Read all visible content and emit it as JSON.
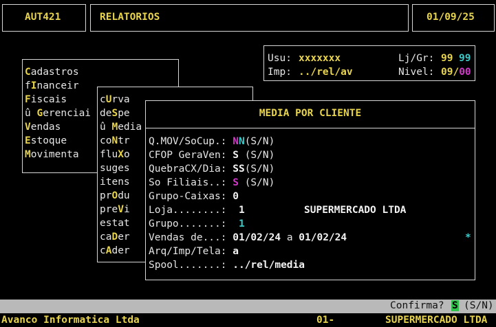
{
  "header": {
    "app_code": "AUT421",
    "section": "RELATORIOS",
    "date": "01/09/25"
  },
  "info_box": {
    "usu_label": "Usu:",
    "usu_value": "xxxxxxx",
    "lj_label": "Lj/Gr:",
    "lj_value": "99",
    "gr_value": "99",
    "imp_label": "Imp:",
    "imp_value": "../rel/av",
    "nivel_label": "Nivel:",
    "nivel_value": "09/",
    "nivel_value2": "00"
  },
  "main_menu": {
    "items": [
      {
        "pre": "",
        "hot": "C",
        "post": "adastros"
      },
      {
        "pre": "f",
        "hot": "I",
        "post": "nanceir"
      },
      {
        "pre": "",
        "hot": "F",
        "post": "iscais"
      },
      {
        "pre": "û ",
        "hot": "G",
        "post": "erenciai"
      },
      {
        "pre": "",
        "hot": "V",
        "post": "endas"
      },
      {
        "pre": "",
        "hot": "E",
        "post": "stoque"
      },
      {
        "pre": "",
        "hot": "M",
        "post": "ovimenta"
      }
    ]
  },
  "sub_menu": {
    "items": [
      {
        "pre": "c",
        "hot": "U",
        "post": "rva"
      },
      {
        "pre": "de",
        "hot": "S",
        "post": "pe"
      },
      {
        "pre": "û ",
        "hot": "M",
        "post": "edia"
      },
      {
        "pre": "co",
        "hot": "N",
        "post": "tr"
      },
      {
        "pre": "flu",
        "hot": "X",
        "post": "o"
      },
      {
        "pre": "suges",
        "hot": "",
        "post": ""
      },
      {
        "pre": "itens",
        "hot": "",
        "post": ""
      },
      {
        "pre": "pr",
        "hot": "O",
        "post": "du"
      },
      {
        "pre": "pre",
        "hot": "V",
        "post": "i"
      },
      {
        "pre": "estat",
        "hot": "",
        "post": ""
      },
      {
        "pre": "ca",
        "hot": "D",
        "post": "er"
      },
      {
        "pre": "c",
        "hot": "A",
        "post": "der"
      }
    ]
  },
  "dialog": {
    "title": "MEDIA POR CLIENTE",
    "fields": {
      "qmov": {
        "label": "Q.MOV/SoCup.:",
        "v1": "N",
        "v2": "N",
        "hint": "(S/N)"
      },
      "cfop": {
        "label": "CFOP GeraVen:",
        "v1": "S",
        "hint": " (S/N)"
      },
      "quebra": {
        "label": "QuebraCX/Dia:",
        "v1": "SS",
        "hint": "(S/N)"
      },
      "filiais": {
        "label": "So Filiais..:",
        "v1": "S",
        "hint": " (S/N)"
      },
      "grupo_caixas": {
        "label": "Grupo-Caixas:",
        "v1": "0"
      },
      "loja": {
        "label": "Loja........:",
        "v1": "1",
        "name": "SUPERMERCADO LTDA"
      },
      "grupo": {
        "label": "Grupo.......:",
        "v1": "1"
      },
      "vendas": {
        "label": "Vendas de...:",
        "from": "01/02/24",
        "sep": "a",
        "to": "01/02/24",
        "mark": "*"
      },
      "arq": {
        "label": "Arq/Imp/Tela:",
        "v1": "a"
      },
      "spool": {
        "label": "Spool.......:",
        "v1": "../rel/media"
      }
    }
  },
  "confirm_bar": {
    "label": "Confirma?",
    "value": "S",
    "hint": "(S/N)"
  },
  "status_bar": {
    "company": "Avanco Informatica Ltda",
    "code": "01-",
    "store": "SUPERMERCADO LTDA"
  }
}
